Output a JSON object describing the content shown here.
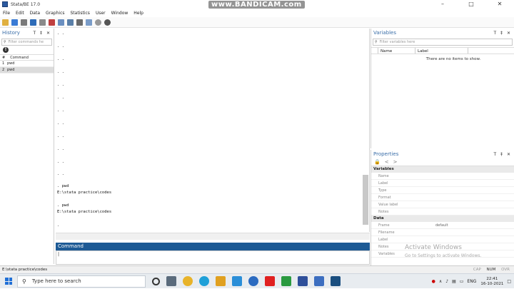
{
  "window": {
    "title": "Stata/BE 17.0",
    "controls": [
      "–",
      "□",
      "✕"
    ]
  },
  "overlay": {
    "watermark": "www.BANDICAM.com"
  },
  "menu": [
    "File",
    "Edit",
    "Data",
    "Graphics",
    "Statistics",
    "User",
    "Window",
    "Help"
  ],
  "history": {
    "title": "History",
    "controls": "T ‡ ✕",
    "filter_placeholder": "Filter commands he",
    "col_num": "#",
    "col_command": "Command",
    "rows": [
      {
        "n": "1",
        "cmd": "pwd"
      },
      {
        "n": "2",
        "cmd": "pwd"
      }
    ]
  },
  "results": {
    "dots": [
      ". .",
      ". .",
      ". .",
      ". .",
      ". .",
      ". .",
      ". .",
      ". .",
      ". .",
      ". .",
      ". .",
      ". ."
    ],
    "lines": [
      ". pwd",
      "E:\\stata practice\\codes",
      ". pwd",
      "E:\\stata practice\\codes",
      "."
    ]
  },
  "command": {
    "title": "Command",
    "value": "|"
  },
  "variables": {
    "title": "Variables",
    "controls": "T ‡ ✕",
    "filter_placeholder": "Filter variables here",
    "col_name": "Name",
    "col_label": "Label",
    "empty": "There are no items to show."
  },
  "properties": {
    "title": "Properties",
    "controls": "T ‡ ✕",
    "nav": [
      "🔒",
      "<",
      ">"
    ],
    "sec_variables": "Variables",
    "variable_rows": [
      "Name",
      "Label",
      "Type",
      "Format",
      "Value label",
      "Notes"
    ],
    "sec_data": "Data",
    "data_rows": [
      {
        "k": "Frame",
        "v": "default"
      },
      {
        "k": "Filename",
        "v": ""
      },
      {
        "k": "Label",
        "v": ""
      },
      {
        "k": "Notes",
        "v": ""
      },
      {
        "k": "Variables",
        "v": ""
      }
    ]
  },
  "activation": {
    "title": "Activate Windows",
    "sub": "Go to Settings to activate Windows."
  },
  "status": {
    "path": "E:\\stata practice\\codes",
    "caps": "CAP",
    "num": "NUM",
    "ovr": "OVR"
  },
  "taskbar": {
    "search_placeholder": "Type here to search",
    "tray_lang": "ENG",
    "time": "22:41",
    "date": "16-10-2021"
  },
  "colors": {
    "accent": "#1d5a95",
    "pane_title": "#3a6ea8"
  }
}
